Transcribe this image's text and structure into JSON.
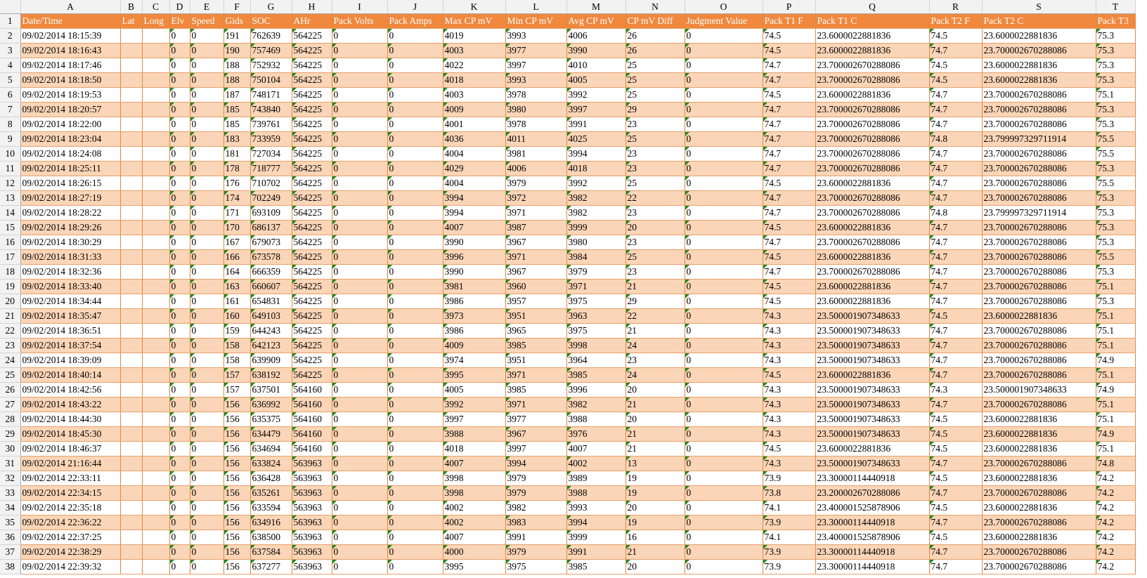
{
  "sheet": {
    "column_letters": [
      "A",
      "B",
      "C",
      "D",
      "E",
      "F",
      "G",
      "H",
      "I",
      "J",
      "K",
      "L",
      "M",
      "N",
      "O",
      "P",
      "Q",
      "R",
      "S",
      "T"
    ],
    "header": [
      "Date/Time",
      "Lat",
      "Long",
      "Elv",
      "Speed",
      "Gids",
      "SOC",
      "AHr",
      "Pack Volts",
      "Pack Amps",
      "Max CP mV",
      "Min CP mV",
      "Avg CP mV",
      "CP mV Diff",
      "Judgment Value",
      "Pack T1 F",
      "Pack T1 C",
      "Pack T2 F",
      "Pack T2 C",
      "Pack T3"
    ],
    "rows": [
      [
        "09/02/2014 18:15:39",
        "",
        "",
        "0",
        "0",
        "191",
        "762639",
        "564225",
        "0",
        "0",
        "4019",
        "3993",
        "4006",
        "26",
        "0",
        "74.5",
        "23.6000022881836",
        "74.5",
        "23.6000022881836",
        "75.3"
      ],
      [
        "09/02/2014 18:16:43",
        "",
        "",
        "0",
        "0",
        "190",
        "757469",
        "564225",
        "0",
        "0",
        "4003",
        "3977",
        "3990",
        "26",
        "0",
        "74.5",
        "23.6000022881836",
        "74.7",
        "23.700002670288086",
        "75.3"
      ],
      [
        "09/02/2014 18:17:46",
        "",
        "",
        "0",
        "0",
        "188",
        "752932",
        "564225",
        "0",
        "0",
        "4022",
        "3997",
        "4010",
        "25",
        "0",
        "74.7",
        "23.700002670288086",
        "74.5",
        "23.6000022881836",
        "75.3"
      ],
      [
        "09/02/2014 18:18:50",
        "",
        "",
        "0",
        "0",
        "188",
        "750104",
        "564225",
        "0",
        "0",
        "4018",
        "3993",
        "4005",
        "25",
        "0",
        "74.7",
        "23.700002670288086",
        "74.5",
        "23.6000022881836",
        "75.3"
      ],
      [
        "09/02/2014 18:19:53",
        "",
        "",
        "0",
        "0",
        "187",
        "748171",
        "564225",
        "0",
        "0",
        "4003",
        "3978",
        "3992",
        "25",
        "0",
        "74.5",
        "23.6000022881836",
        "74.7",
        "23.700002670288086",
        "75.1"
      ],
      [
        "09/02/2014 18:20:57",
        "",
        "",
        "0",
        "0",
        "185",
        "743840",
        "564225",
        "0",
        "0",
        "4009",
        "3980",
        "3997",
        "29",
        "0",
        "74.7",
        "23.700002670288086",
        "74.7",
        "23.700002670288086",
        "75.3"
      ],
      [
        "09/02/2014 18:22:00",
        "",
        "",
        "0",
        "0",
        "185",
        "739761",
        "564225",
        "0",
        "0",
        "4001",
        "3978",
        "3991",
        "23",
        "0",
        "74.7",
        "23.700002670288086",
        "74.7",
        "23.700002670288086",
        "75.3"
      ],
      [
        "09/02/2014 18:23:04",
        "",
        "",
        "0",
        "0",
        "183",
        "733959",
        "564225",
        "0",
        "0",
        "4036",
        "4011",
        "4025",
        "25",
        "0",
        "74.7",
        "23.700002670288086",
        "74.8",
        "23.799997329711914",
        "75.5"
      ],
      [
        "09/02/2014 18:24:08",
        "",
        "",
        "0",
        "0",
        "181",
        "727034",
        "564225",
        "0",
        "0",
        "4004",
        "3981",
        "3994",
        "23",
        "0",
        "74.7",
        "23.700002670288086",
        "74.7",
        "23.700002670288086",
        "75.5"
      ],
      [
        "09/02/2014 18:25:11",
        "",
        "",
        "0",
        "0",
        "178",
        "718777",
        "564225",
        "0",
        "0",
        "4029",
        "4006",
        "4018",
        "23",
        "0",
        "74.7",
        "23.700002670288086",
        "74.7",
        "23.700002670288086",
        "75.3"
      ],
      [
        "09/02/2014 18:26:15",
        "",
        "",
        "0",
        "0",
        "176",
        "710702",
        "564225",
        "0",
        "0",
        "4004",
        "3979",
        "3992",
        "25",
        "0",
        "74.5",
        "23.6000022881836",
        "74.7",
        "23.700002670288086",
        "75.5"
      ],
      [
        "09/02/2014 18:27:19",
        "",
        "",
        "0",
        "0",
        "174",
        "702249",
        "564225",
        "0",
        "0",
        "3994",
        "3972",
        "3982",
        "22",
        "0",
        "74.7",
        "23.700002670288086",
        "74.7",
        "23.700002670288086",
        "75.3"
      ],
      [
        "09/02/2014 18:28:22",
        "",
        "",
        "0",
        "0",
        "171",
        "693109",
        "564225",
        "0",
        "0",
        "3994",
        "3971",
        "3982",
        "23",
        "0",
        "74.7",
        "23.700002670288086",
        "74.8",
        "23.799997329711914",
        "75.3"
      ],
      [
        "09/02/2014 18:29:26",
        "",
        "",
        "0",
        "0",
        "170",
        "686137",
        "564225",
        "0",
        "0",
        "4007",
        "3987",
        "3999",
        "20",
        "0",
        "74.5",
        "23.6000022881836",
        "74.7",
        "23.700002670288086",
        "75.3"
      ],
      [
        "09/02/2014 18:30:29",
        "",
        "",
        "0",
        "0",
        "167",
        "679073",
        "564225",
        "0",
        "0",
        "3990",
        "3967",
        "3980",
        "23",
        "0",
        "74.7",
        "23.700002670288086",
        "74.7",
        "23.700002670288086",
        "75.3"
      ],
      [
        "09/02/2014 18:31:33",
        "",
        "",
        "0",
        "0",
        "166",
        "673578",
        "564225",
        "0",
        "0",
        "3996",
        "3971",
        "3984",
        "25",
        "0",
        "74.5",
        "23.6000022881836",
        "74.7",
        "23.700002670288086",
        "75.5"
      ],
      [
        "09/02/2014 18:32:36",
        "",
        "",
        "0",
        "0",
        "164",
        "666359",
        "564225",
        "0",
        "0",
        "3990",
        "3967",
        "3979",
        "23",
        "0",
        "74.7",
        "23.700002670288086",
        "74.7",
        "23.700002670288086",
        "75.3"
      ],
      [
        "09/02/2014 18:33:40",
        "",
        "",
        "0",
        "0",
        "163",
        "660607",
        "564225",
        "0",
        "0",
        "3981",
        "3960",
        "3971",
        "21",
        "0",
        "74.5",
        "23.6000022881836",
        "74.7",
        "23.700002670288086",
        "75.1"
      ],
      [
        "09/02/2014 18:34:44",
        "",
        "",
        "0",
        "0",
        "161",
        "654831",
        "564225",
        "0",
        "0",
        "3986",
        "3957",
        "3975",
        "29",
        "0",
        "74.5",
        "23.6000022881836",
        "74.7",
        "23.700002670288086",
        "75.3"
      ],
      [
        "09/02/2014 18:35:47",
        "",
        "",
        "0",
        "0",
        "160",
        "649103",
        "564225",
        "0",
        "0",
        "3973",
        "3951",
        "3963",
        "22",
        "0",
        "74.3",
        "23.500001907348633",
        "74.5",
        "23.6000022881836",
        "75.1"
      ],
      [
        "09/02/2014 18:36:51",
        "",
        "",
        "0",
        "0",
        "159",
        "644243",
        "564225",
        "0",
        "0",
        "3986",
        "3965",
        "3975",
        "21",
        "0",
        "74.3",
        "23.500001907348633",
        "74.7",
        "23.700002670288086",
        "75.1"
      ],
      [
        "09/02/2014 18:37:54",
        "",
        "",
        "0",
        "0",
        "158",
        "642123",
        "564225",
        "0",
        "0",
        "4009",
        "3985",
        "3998",
        "24",
        "0",
        "74.3",
        "23.500001907348633",
        "74.7",
        "23.700002670288086",
        "75.1"
      ],
      [
        "09/02/2014 18:39:09",
        "",
        "",
        "0",
        "0",
        "158",
        "639909",
        "564225",
        "0",
        "0",
        "3974",
        "3951",
        "3964",
        "23",
        "0",
        "74.3",
        "23.500001907348633",
        "74.7",
        "23.700002670288086",
        "74.9"
      ],
      [
        "09/02/2014 18:40:14",
        "",
        "",
        "0",
        "0",
        "157",
        "638192",
        "564225",
        "0",
        "0",
        "3995",
        "3971",
        "3985",
        "24",
        "0",
        "74.5",
        "23.6000022881836",
        "74.7",
        "23.700002670288086",
        "75.1"
      ],
      [
        "09/02/2014 18:42:56",
        "",
        "",
        "0",
        "0",
        "157",
        "637501",
        "564160",
        "0",
        "0",
        "4005",
        "3985",
        "3996",
        "20",
        "0",
        "74.3",
        "23.500001907348633",
        "74.3",
        "23.500001907348633",
        "74.9"
      ],
      [
        "09/02/2014 18:43:22",
        "",
        "",
        "0",
        "0",
        "156",
        "636992",
        "564160",
        "0",
        "0",
        "3992",
        "3971",
        "3982",
        "21",
        "0",
        "74.3",
        "23.500001907348633",
        "74.7",
        "23.700002670288086",
        "75.1"
      ],
      [
        "09/02/2014 18:44:30",
        "",
        "",
        "0",
        "0",
        "156",
        "635375",
        "564160",
        "0",
        "0",
        "3997",
        "3977",
        "3988",
        "20",
        "0",
        "74.3",
        "23.500001907348633",
        "74.5",
        "23.6000022881836",
        "75.1"
      ],
      [
        "09/02/2014 18:45:30",
        "",
        "",
        "0",
        "0",
        "156",
        "634479",
        "564160",
        "0",
        "0",
        "3988",
        "3967",
        "3976",
        "21",
        "0",
        "74.3",
        "23.500001907348633",
        "74.5",
        "23.6000022881836",
        "74.9"
      ],
      [
        "09/02/2014 18:46:37",
        "",
        "",
        "0",
        "0",
        "156",
        "634694",
        "564160",
        "0",
        "0",
        "4018",
        "3997",
        "4007",
        "21",
        "0",
        "74.5",
        "23.6000022881836",
        "74.5",
        "23.6000022881836",
        "75.1"
      ],
      [
        "09/02/2014 21:16:44",
        "",
        "",
        "0",
        "0",
        "156",
        "633824",
        "563963",
        "0",
        "0",
        "4007",
        "3994",
        "4002",
        "13",
        "0",
        "74.3",
        "23.500001907348633",
        "74.7",
        "23.700002670288086",
        "74.8"
      ],
      [
        "09/02/2014 22:33:11",
        "",
        "",
        "0",
        "0",
        "156",
        "636428",
        "563963",
        "0",
        "0",
        "3998",
        "3979",
        "3989",
        "19",
        "0",
        "73.9",
        "23.30000114440918",
        "74.5",
        "23.6000022881836",
        "74.2"
      ],
      [
        "09/02/2014 22:34:15",
        "",
        "",
        "0",
        "0",
        "156",
        "635261",
        "563963",
        "0",
        "0",
        "3998",
        "3979",
        "3988",
        "19",
        "0",
        "73.8",
        "23.200002670288086",
        "74.7",
        "23.700002670288086",
        "74.2"
      ],
      [
        "09/02/2014 22:35:18",
        "",
        "",
        "0",
        "0",
        "156",
        "633594",
        "563963",
        "0",
        "0",
        "4002",
        "3982",
        "3993",
        "20",
        "0",
        "74.1",
        "23.400001525878906",
        "74.5",
        "23.6000022881836",
        "74.2"
      ],
      [
        "09/02/2014 22:36:22",
        "",
        "",
        "0",
        "0",
        "156",
        "634916",
        "563963",
        "0",
        "0",
        "4002",
        "3983",
        "3994",
        "19",
        "0",
        "73.9",
        "23.30000114440918",
        "74.7",
        "23.700002670288086",
        "74.2"
      ],
      [
        "09/02/2014 22:37:25",
        "",
        "",
        "0",
        "0",
        "156",
        "638500",
        "563963",
        "0",
        "0",
        "4007",
        "3991",
        "3999",
        "16",
        "0",
        "74.1",
        "23.400001525878906",
        "74.5",
        "23.6000022881836",
        "74.2"
      ],
      [
        "09/02/2014 22:38:29",
        "",
        "",
        "0",
        "0",
        "156",
        "637584",
        "563963",
        "0",
        "0",
        "4000",
        "3979",
        "3991",
        "21",
        "0",
        "73.9",
        "23.30000114440918",
        "74.7",
        "23.700002670288086",
        "74.2"
      ],
      [
        "09/02/2014 22:39:32",
        "",
        "",
        "0",
        "0",
        "156",
        "637277",
        "563963",
        "0",
        "0",
        "3995",
        "3975",
        "3985",
        "20",
        "0",
        "73.9",
        "23.30000114440918",
        "74.7",
        "23.700002670288086",
        "74.2"
      ]
    ],
    "colors": {
      "header_fill": "#f0883e",
      "header_text": "#ffffff",
      "band_fill": "#fbd5b7",
      "row_fill": "#ffffff",
      "error_indicator": "#1e8a1e"
    }
  }
}
